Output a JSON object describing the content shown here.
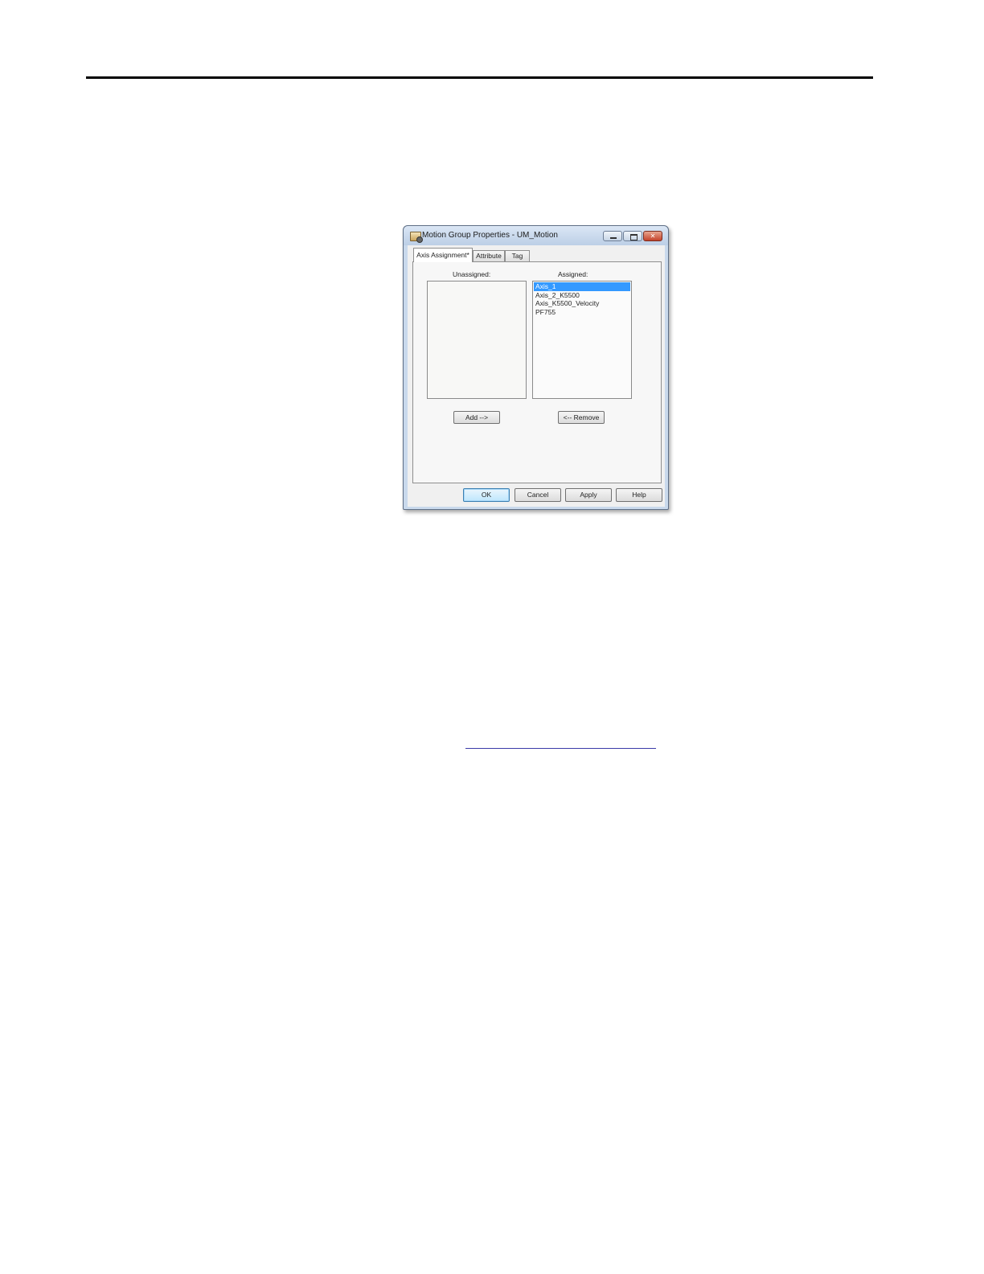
{
  "window": {
    "title": "Motion Group Properties - UM_Motion"
  },
  "tabs": [
    {
      "label": "Axis Assignment*"
    },
    {
      "label": "Attribute"
    },
    {
      "label": "Tag"
    }
  ],
  "panel": {
    "unassigned_label": "Unassigned:",
    "assigned_label": "Assigned:",
    "unassigned_items": [],
    "assigned_items": [
      {
        "label": "Axis_1",
        "selected": true
      },
      {
        "label": "Axis_2_K5500",
        "selected": false
      },
      {
        "label": "Axis_K5500_Velocity",
        "selected": false
      },
      {
        "label": "PF755",
        "selected": false
      }
    ],
    "add_label": "Add -->",
    "remove_label": "<-- Remove"
  },
  "footer": {
    "ok_label": "OK",
    "cancel_label": "Cancel",
    "apply_label": "Apply",
    "help_label": "Help"
  }
}
